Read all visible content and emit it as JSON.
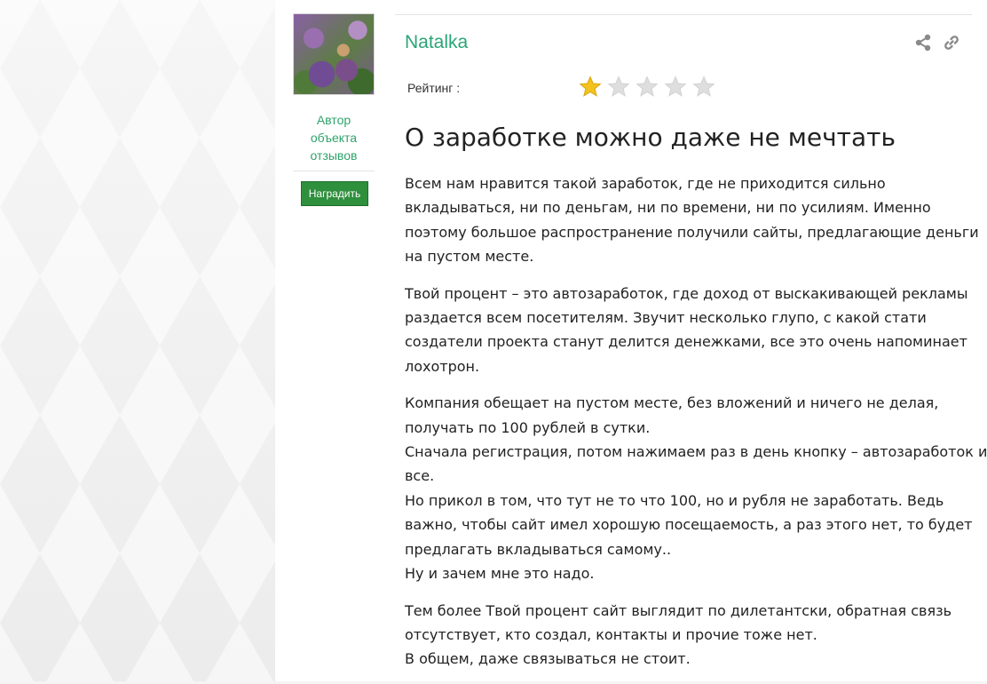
{
  "author": {
    "role_line1": "Автор",
    "role_line2": "объекта",
    "role_line3": "отзывов",
    "reward_label": "Наградить"
  },
  "review": {
    "author_name": "Natalka",
    "rating_label": "Рейтинг :",
    "rating_value": 1,
    "rating_max": 5,
    "title": "О заработке можно даже не мечтать",
    "paragraphs": [
      [
        "Всем нам нравится такой заработок, где не приходится сильно",
        "вкладываться, ни по деньгам, ни по времени, ни по усилиям. Именно",
        "поэтому большое распространение получили сайты, предлагающие деньги",
        "на пустом месте."
      ],
      [
        "Твой процент – это автозаработок, где доход от выскакивающей рекламы",
        "раздается всем посетителям. Звучит несколько глупо, с какой стати",
        "создатели проекта станут делится денежками, все это очень напоминает",
        "лохотрон."
      ],
      [
        "Компания обещает на пустом месте, без вложений и ничего не делая,",
        "получать по 100 рублей в сутки.",
        "Сначала регистрация, потом нажимаем раз в день кнопку – автозаработок и",
        "все.",
        "Но прикол в том, что тут не то что 100, но и рубля не заработать. Ведь",
        "важно, чтобы сайт имел хорошую посещаемость, а раз этого нет, то будет",
        "предлагать вкладываться самому..",
        "Ну и зачем мне это надо."
      ],
      [
        "Тем более Твой процент сайт выглядит по дилетантски, обратная связь",
        "отсутствует, кто создал, контакты и прочие тоже нет.",
        "В общем, даже связываться не стоит."
      ]
    ]
  },
  "icons": {
    "share": "share-icon",
    "link": "link-icon",
    "star_filled": "star-filled-icon",
    "star_empty": "star-empty-icon"
  },
  "colors": {
    "accent_green": "#2aa577",
    "button_green": "#2e8f3c",
    "star_gold": "#f3c21d",
    "star_empty": "#dedede"
  }
}
